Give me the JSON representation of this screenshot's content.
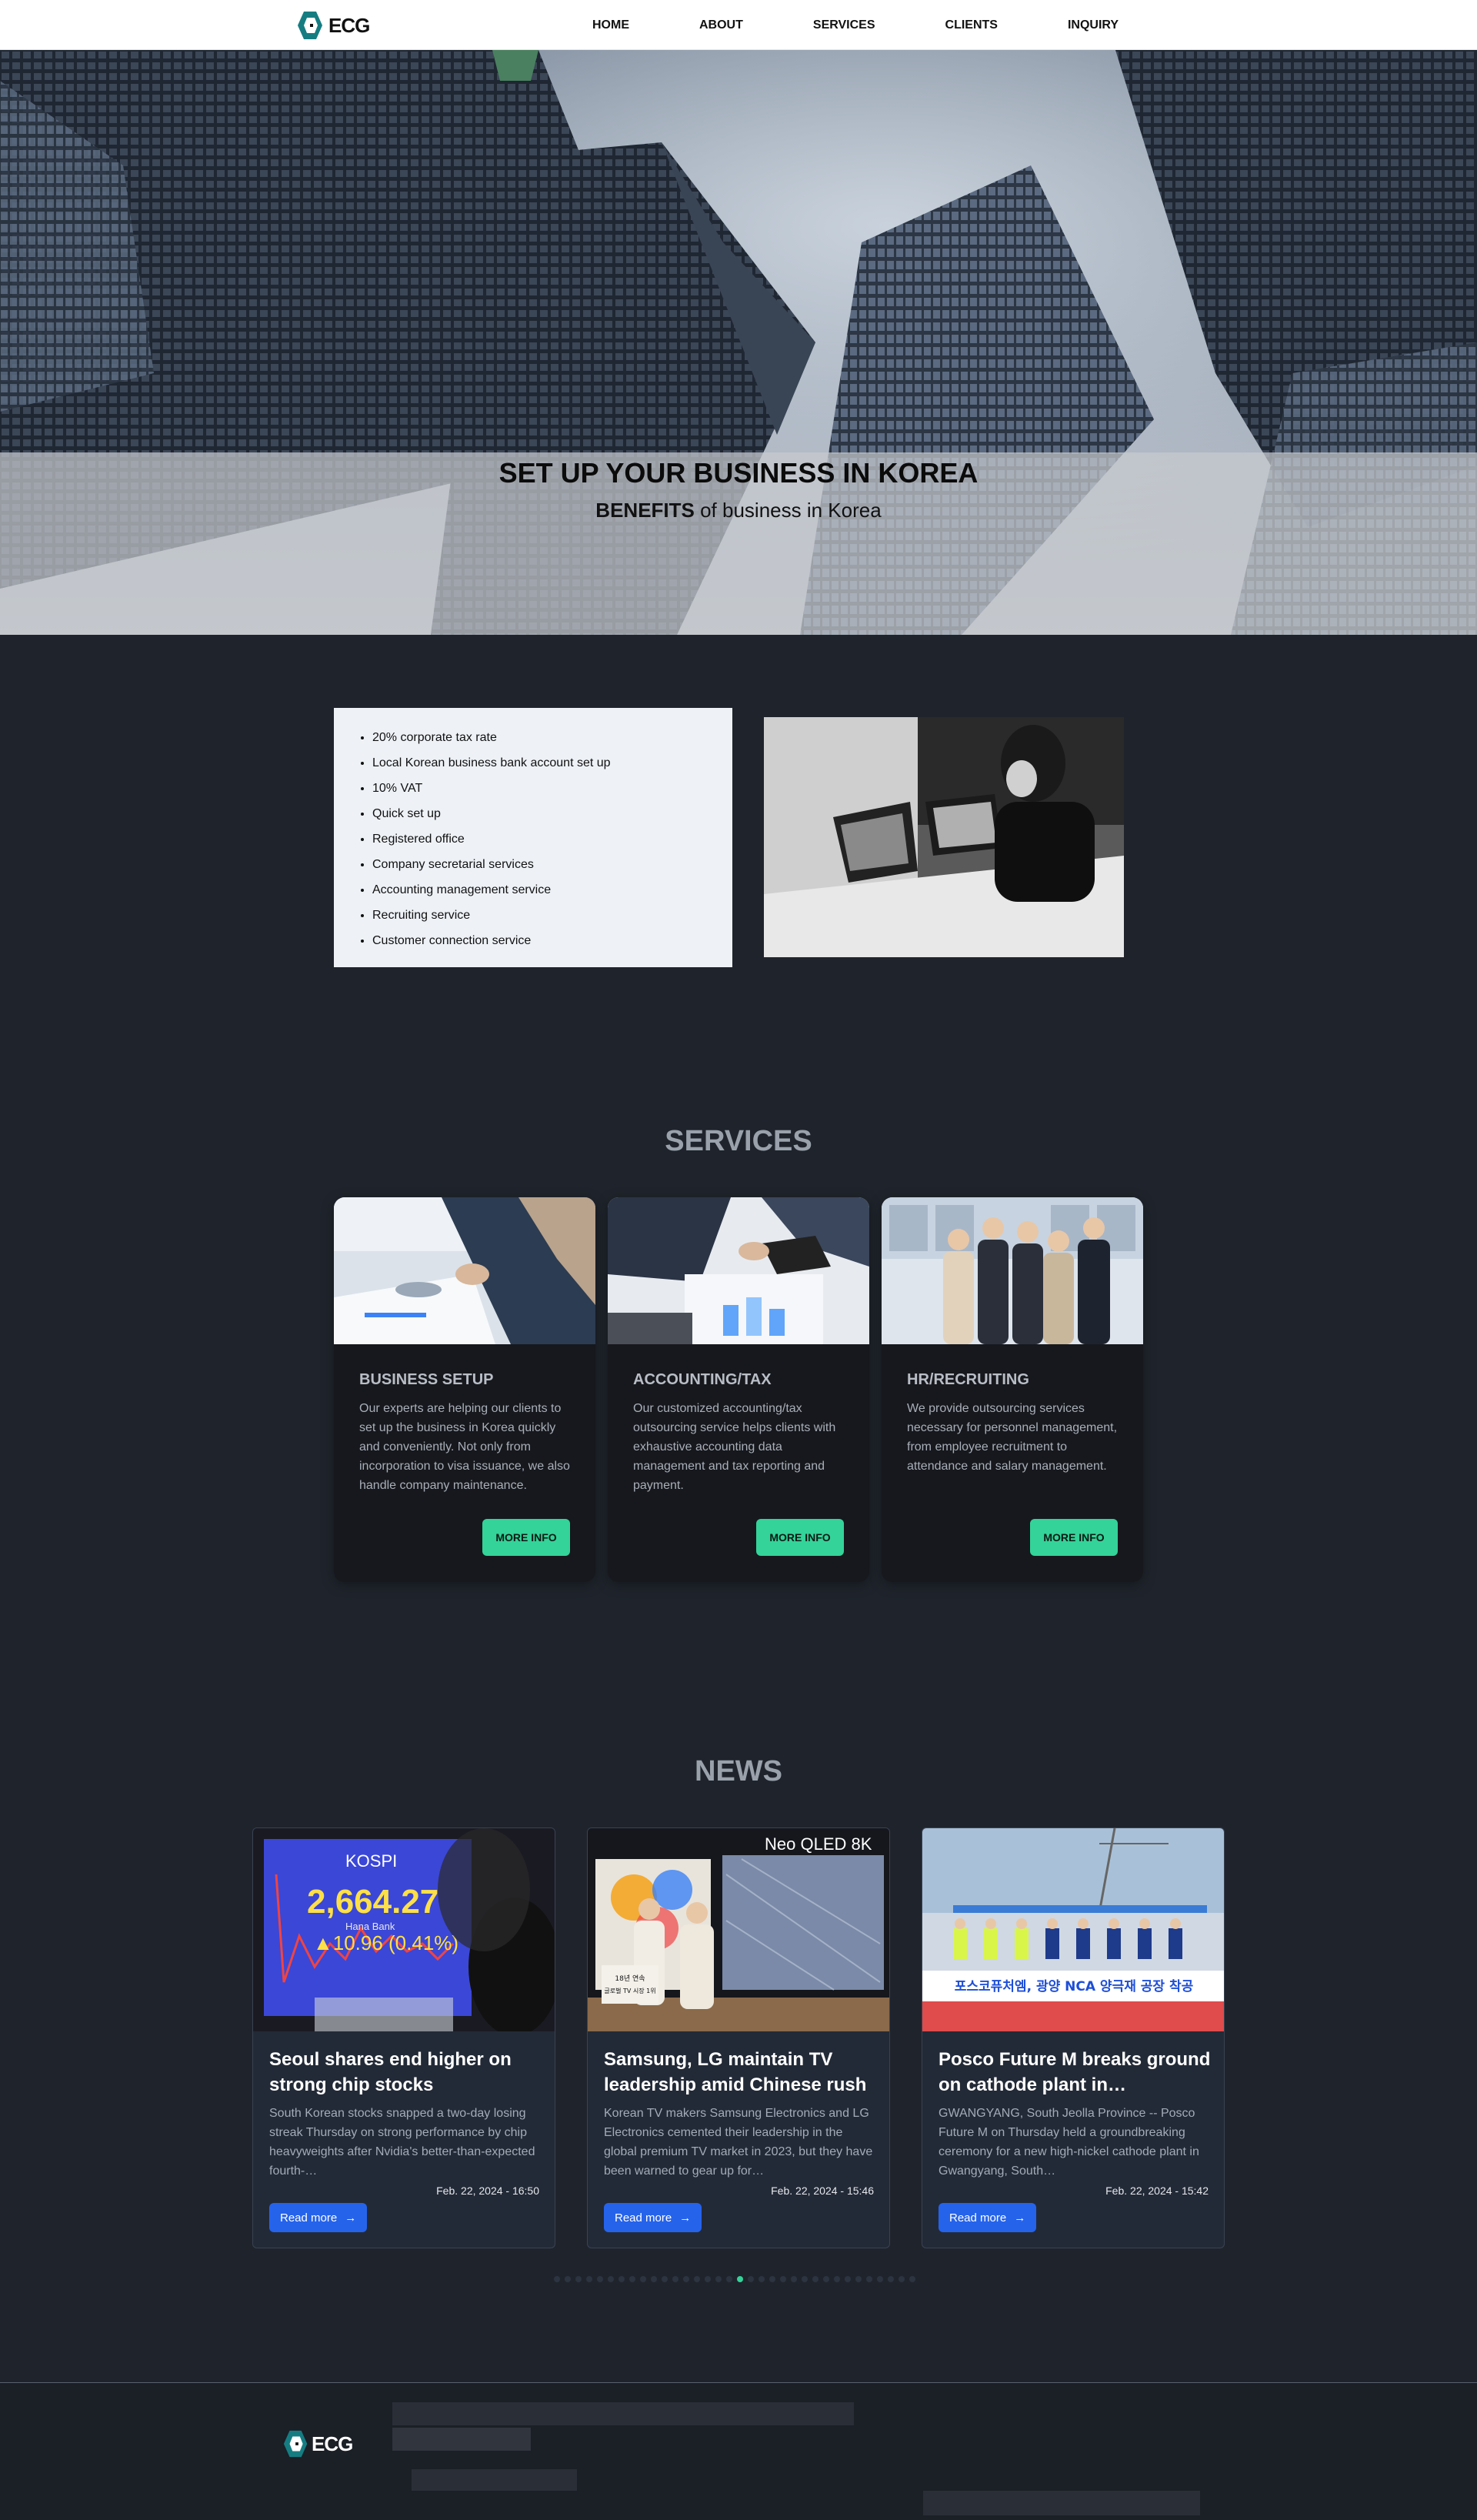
{
  "brand": {
    "logo_text": "ECG",
    "accent": "#1a8a8e"
  },
  "nav": {
    "items": [
      "HOME",
      "ABOUT",
      "SERVICES",
      "CLIENTS",
      "INQUIRY"
    ]
  },
  "hero": {
    "title": "SET UP YOUR BUSINESS IN KOREA",
    "subtitle_bold": "BENEFITS",
    "subtitle_rest": " of business in Korea"
  },
  "benefits": [
    "20% corporate tax rate",
    "Local Korean business bank account set up",
    "10% VAT",
    "Quick set up",
    "Registered office",
    "Company secretarial services",
    "Accounting management service",
    "Recruiting service",
    "Customer connection service"
  ],
  "services": {
    "title": "SERVICES",
    "button_label": "MORE INFO",
    "items": [
      {
        "name": "BUSINESS SETUP",
        "description": "Our experts are helping our clients to set up the business in Korea quickly and conveniently. Not only from incorporation to visa issuance, we also handle company maintenance."
      },
      {
        "name": "ACCOUNTING/TAX",
        "description": "Our customized accounting/tax outsourcing service helps clients with exhaustive accounting data management and tax reporting and payment."
      },
      {
        "name": "HR/RECRUITING",
        "description": "We provide outsourcing services necessary for personnel management, from employee recruitment to attendance and salary management."
      }
    ]
  },
  "news": {
    "title": "NEWS",
    "button_label": "Read more",
    "items": [
      {
        "headline": "Seoul shares end higher on strong chip stocks",
        "summary": "South Korean stocks snapped a two-day losing streak Thursday on strong performance by chip heavyweights after Nvidia's better-than-expected fourth-…",
        "date": "Feb. 22, 2024 - 16:50",
        "img_text": {
          "title": "KOSPI",
          "value": "2,664.27",
          "change": "▲10.96 (0.41%)",
          "bank": "Hana Bank"
        }
      },
      {
        "headline": "Samsung, LG maintain TV leadership amid Chinese rush",
        "summary": "Korean TV makers Samsung Electronics and LG Electronics cemented their leadership in the global premium TV market in 2023, but they have been warned to gear up for…",
        "date": "Feb. 22, 2024 - 15:46",
        "img_text": {
          "banner": "Neo QLED 8K",
          "sign_1": "18년 연속",
          "sign_2": "글로벌 TV 시장 1위"
        }
      },
      {
        "headline": "Posco Future M breaks ground on cathode plant in…",
        "summary": "GWANGYANG, South Jeolla Province -- Posco Future M on Thursday held a groundbreaking ceremony for a new high-nickel cathode plant in Gwangyang, South…",
        "date": "Feb. 22, 2024 - 15:42",
        "img_text": {
          "banner": "포스코퓨처엠, 광양 NCA 양극재 공장 착공"
        }
      }
    ],
    "dots_count": 34,
    "active_dot": 17
  },
  "footer": {
    "logo_text": "ECG"
  }
}
